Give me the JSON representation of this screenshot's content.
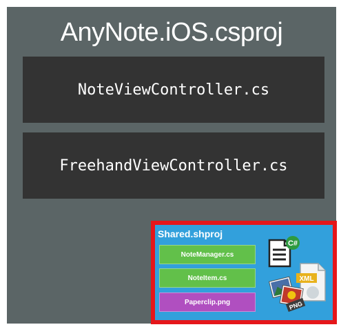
{
  "project": {
    "title_prefix": "AnyNote.",
    "title_bold": "iOS",
    "title_suffix": ".csproj"
  },
  "files": [
    "NoteViewController.cs",
    "FreehandViewController.cs"
  ],
  "shared": {
    "title": "Shared.shproj",
    "items": [
      {
        "label": "NoteManager.cs",
        "color": "#62c04a"
      },
      {
        "label": "NoteItem.cs",
        "color": "#62c04a"
      },
      {
        "label": "Paperclip.png",
        "color": "#b04fc0"
      }
    ],
    "icons": {
      "cs_badge": "C#",
      "xml_label": "XML",
      "png_label": "PNG"
    },
    "highlight_border_color": "#e5161a",
    "background_color": "#32a0dc"
  },
  "panel_color": "#5b6566",
  "file_box_color": "#333333"
}
